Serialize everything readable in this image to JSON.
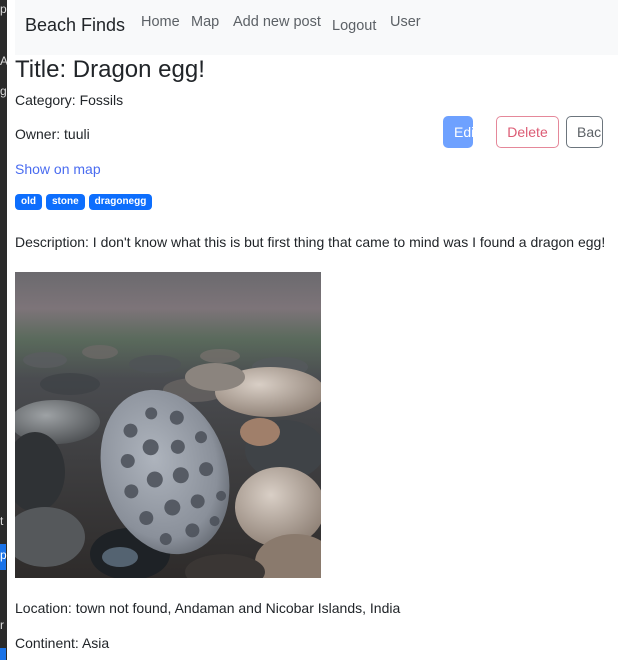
{
  "navbar": {
    "brand": "Beach Finds",
    "links": [
      "Home",
      "Map",
      "Add new post",
      "Logout",
      "User"
    ]
  },
  "post": {
    "title": "Title: Dragon egg!",
    "category": "Category: Fossils",
    "owner": "Owner: tuuli",
    "show_on_map": "Show on map",
    "tags": [
      "old",
      "stone",
      "dragonegg"
    ],
    "description": "Description: I don't know what this is but first thing that came to mind was I found a dragon egg!",
    "location": "Location: town not found, Andaman and Nicobar Islands, India",
    "continent": "Continent: Asia"
  },
  "actions": {
    "edit_label": "Edit",
    "delete_label": "Delete",
    "back_label": "Back"
  },
  "colors": {
    "primary": "#0d6efd",
    "edit_button": "#6ea1ff",
    "delete_outline": "#e5889a",
    "link": "#4a6cf0",
    "navbar_bg": "#f8f9fa"
  },
  "edge_window": {
    "fragments": [
      "p",
      "A",
      "g",
      "t",
      "p",
      "r"
    ]
  }
}
